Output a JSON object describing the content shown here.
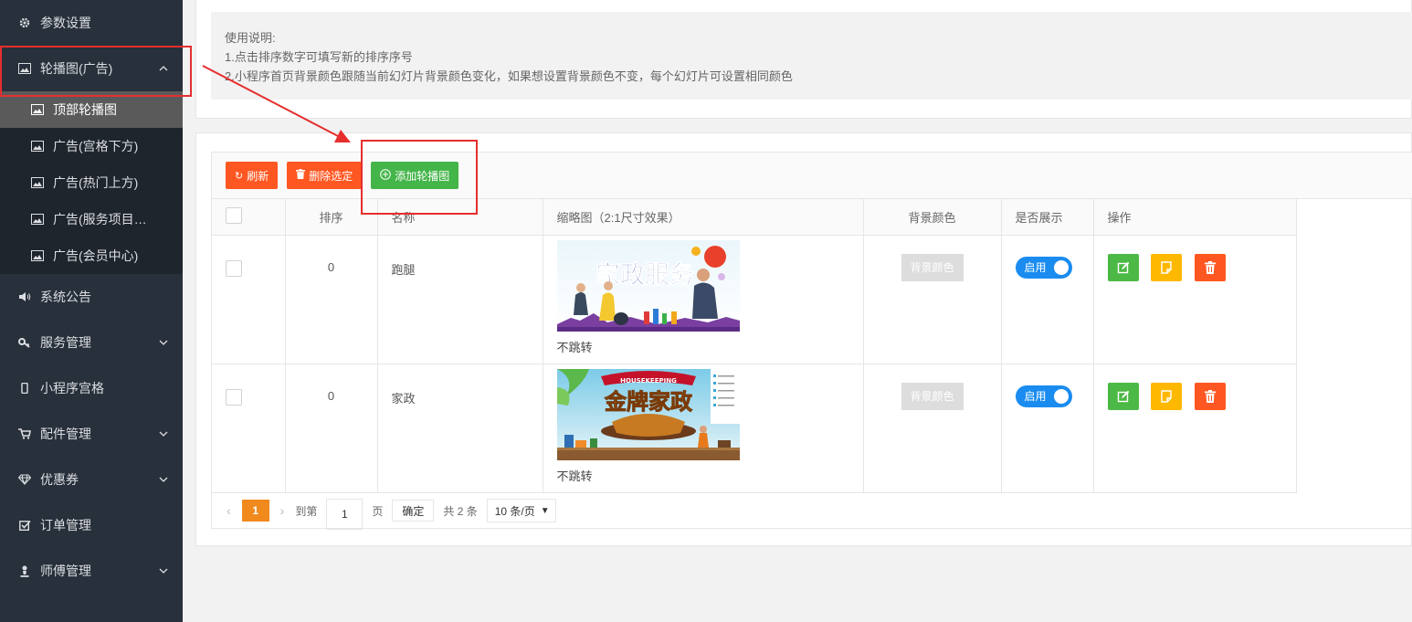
{
  "sidebar": {
    "items": [
      {
        "label": "参数设置",
        "icon": "gear-icon"
      },
      {
        "label": "轮播图(广告)",
        "icon": "image-icon"
      },
      {
        "label": "系统公告",
        "icon": "speaker-icon"
      },
      {
        "label": "服务管理",
        "icon": "key-icon"
      },
      {
        "label": "小程序宫格",
        "icon": "mobile-icon"
      },
      {
        "label": "配件管理",
        "icon": "cart-icon"
      },
      {
        "label": "优惠券",
        "icon": "diamond-icon"
      },
      {
        "label": "订单管理",
        "icon": "checkbox-icon"
      },
      {
        "label": "师傅管理",
        "icon": "worker-icon"
      }
    ],
    "submenu": [
      {
        "label": "顶部轮播图",
        "active": true
      },
      {
        "label": "广告(宫格下方)"
      },
      {
        "label": "广告(热门上方)"
      },
      {
        "label": "广告(服务项目…"
      },
      {
        "label": "广告(会员中心)"
      }
    ]
  },
  "tip": {
    "title": "使用说明:",
    "line1": "1.点击排序数字可填写新的排序序号",
    "line2": "2.小程序首页背景颜色跟随当前幻灯片背景颜色变化，如果想设置背景颜色不变，每个幻灯片可设置相同颜色"
  },
  "toolbar": {
    "refresh": "刷新",
    "delete_selected": "删除选定",
    "add": "添加轮播图"
  },
  "table": {
    "headers": [
      "排序",
      "名称",
      "缩略图（2:1尺寸效果）",
      "背景颜色",
      "是否展示",
      "操作"
    ],
    "rows": [
      {
        "sort": "0",
        "name": "跑腿",
        "thumb_caption": "不跳转",
        "bg_label": "背景颜色",
        "switch_label": "启用",
        "banner_text": "家政服务"
      },
      {
        "sort": "0",
        "name": "家政",
        "thumb_caption": "不跳转",
        "bg_label": "背景颜色",
        "switch_label": "启用",
        "banner_text": "金牌家政"
      }
    ]
  },
  "pager": {
    "current": "1",
    "goto_label": "到第",
    "goto_value": "1",
    "page_label": "页",
    "ok_label": "确定",
    "total": "共 2 条",
    "page_size": "10 条/页"
  },
  "colors": {
    "sidebar_bg": "#28303b",
    "orange": "#ff5722",
    "green": "#44b549",
    "yellow": "#ffb800",
    "blue": "#1a8cf0",
    "annotation": "#e62e2e"
  }
}
